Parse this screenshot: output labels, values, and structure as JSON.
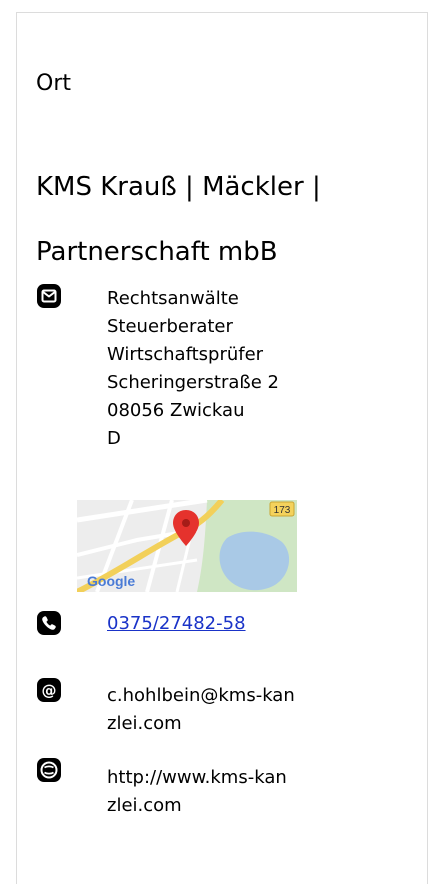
{
  "location": {
    "heading": "Ort",
    "company_name": "KMS Krauß | Mäckler | Partnerschaft mbB",
    "address": {
      "icon": "envelope-icon",
      "lines": [
        "Rechtsanwälte",
        "Steuerberater",
        "Wirtschaftsprüfer",
        "Scheringerstraße 2",
        "08056 Zwickau",
        "D"
      ]
    },
    "map": {
      "road_badge": "173",
      "logo_text": "Google",
      "marker_color": "#e5322d"
    },
    "phone": {
      "icon": "phone-icon",
      "number": "0375/27482-58"
    },
    "email": {
      "icon": "at-icon",
      "address": "c.hohlbein@kms-kanzlei.com"
    },
    "website": {
      "icon": "web-icon",
      "url": "http://www.kms-kanzlei.com"
    }
  },
  "colors": {
    "link": "#1a33c8",
    "border": "#dcdcdc"
  }
}
